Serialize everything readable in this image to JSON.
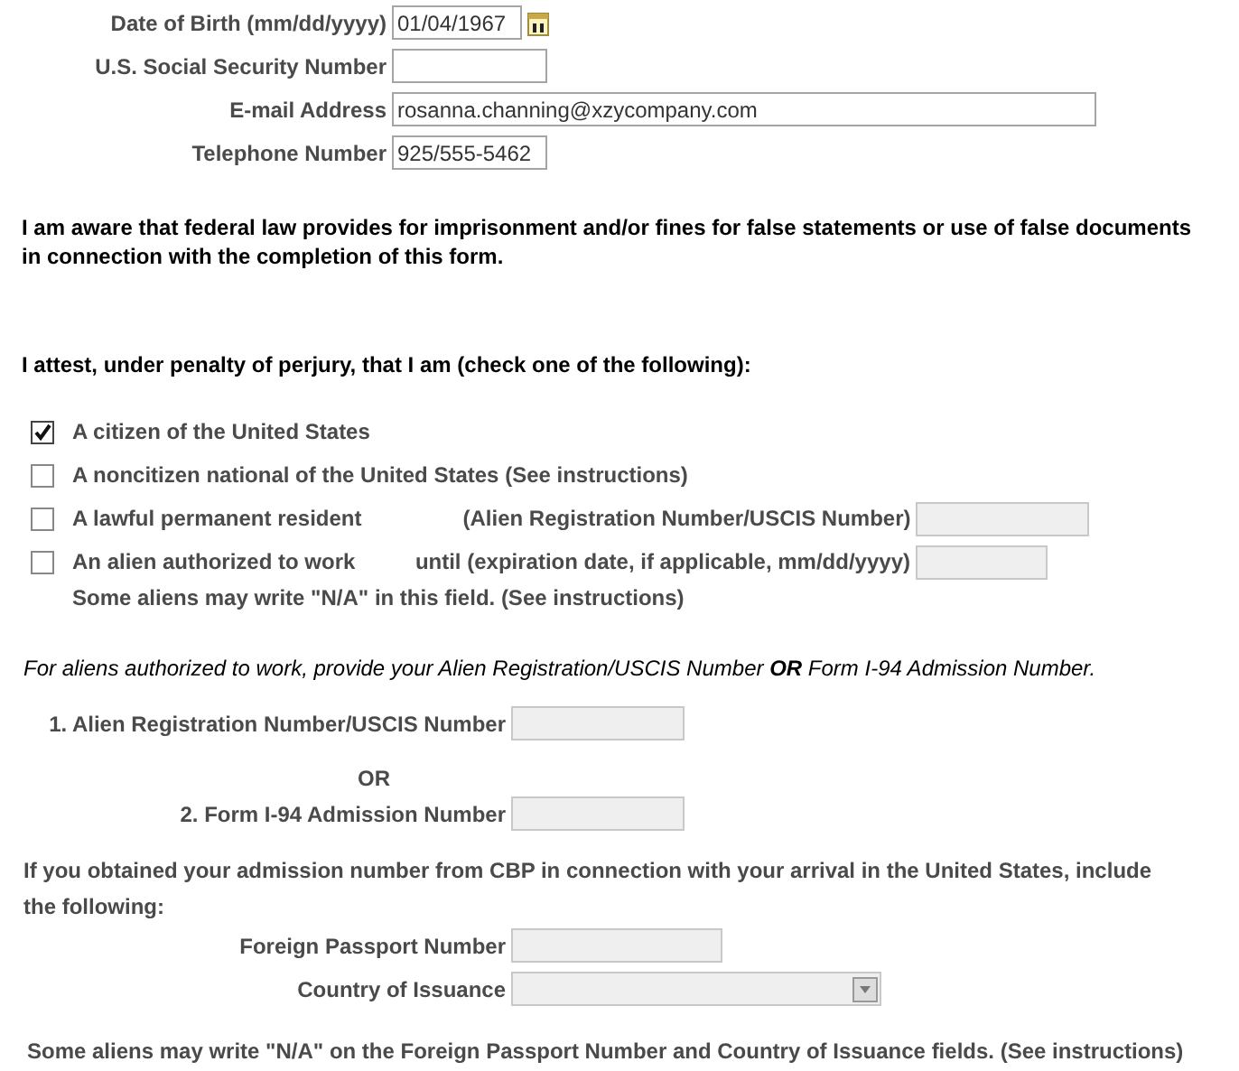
{
  "personal_fields": [
    {
      "label": "Date of Birth (mm/dd/yyyy)",
      "value": "01/04/1967",
      "kind": "date"
    },
    {
      "label": "U.S. Social Security Number",
      "kind": "short"
    },
    {
      "label": "E-mail Address",
      "value": "rosanna.channing@xzycompany.com",
      "kind": "long"
    },
    {
      "label": "Telephone Number",
      "value": "925/555-5462",
      "kind": "short"
    }
  ],
  "warning": "I am aware that federal law provides for imprisonment and/or fines for false statements or use of false documents in connection with the completion of this form.",
  "attest_prompt": "I attest, under penalty of perjury, that I am (check one of the following):",
  "status_options": [
    {
      "label": "A citizen of the United States",
      "checked": true
    },
    {
      "label": "A noncitizen national of the United States (See instructions)",
      "checked": false
    },
    {
      "label": "A lawful permanent resident",
      "checked": false,
      "field_label": "(Alien Registration Number/USCIS Number)",
      "field_disabled": true,
      "kind": "number_field"
    },
    {
      "label": "An alien authorized to work",
      "checked": false,
      "field_label": "until (expiration date, if applicable, mm/dd/yyyy)",
      "field_disabled": true,
      "kind": "date_field",
      "note": "Some aliens may write \"N/A\" in this field. (See instructions)"
    }
  ],
  "alien_instructions": "For aliens authorized to work, provide your Alien Registration/USCIS Number **OR** Form I-94 Admission Number.",
  "alien_fields": [
    {
      "label": "1. Alien Registration Number/USCIS Number",
      "disabled": true
    },
    {
      "label": "OR",
      "kind": "separator"
    },
    {
      "label": "2. Form I-94 Admission Number",
      "disabled": true
    }
  ],
  "cbp_text": "If you obtained your admission number from CBP in connection with your arrival in the United States, include the following:",
  "cbp_fields": [
    {
      "label": "Foreign Passport Number",
      "kind": "text",
      "disabled": true
    },
    {
      "label": "Country of Issuance",
      "kind": "select",
      "disabled": true
    }
  ],
  "final_note": "Some aliens may write \"N/A\" on the Foreign Passport Number and Country of Issuance fields. (See instructions)"
}
